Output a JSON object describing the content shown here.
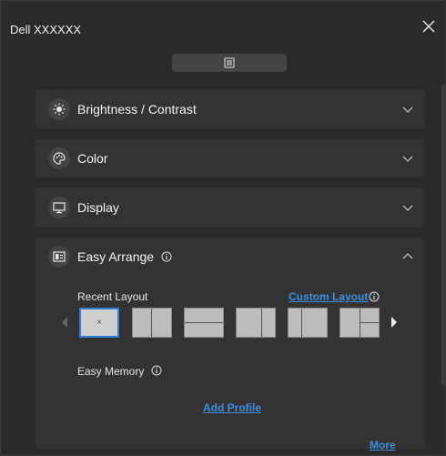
{
  "window": {
    "title": "Dell XXXXXX"
  },
  "panels": [
    {
      "label": "Brightness / Contrast",
      "icon": "sun-icon"
    },
    {
      "label": "Color",
      "icon": "palette-icon"
    },
    {
      "label": "Display",
      "icon": "monitor-icon"
    },
    {
      "label": "Easy Arrange",
      "icon": "layout-icon"
    }
  ],
  "easy_arrange": {
    "recent_layout_label": "Recent Layout",
    "custom_layout_link": "Custom Layout",
    "selected_thumb_mark": "×",
    "easy_memory_label": "Easy Memory",
    "add_profile_link": "Add Profile",
    "more_link": "More"
  },
  "colors": {
    "accent": "#2f7fd6",
    "link": "#3d8fe0",
    "background": "#2b2b2b",
    "panel": "#333333"
  }
}
